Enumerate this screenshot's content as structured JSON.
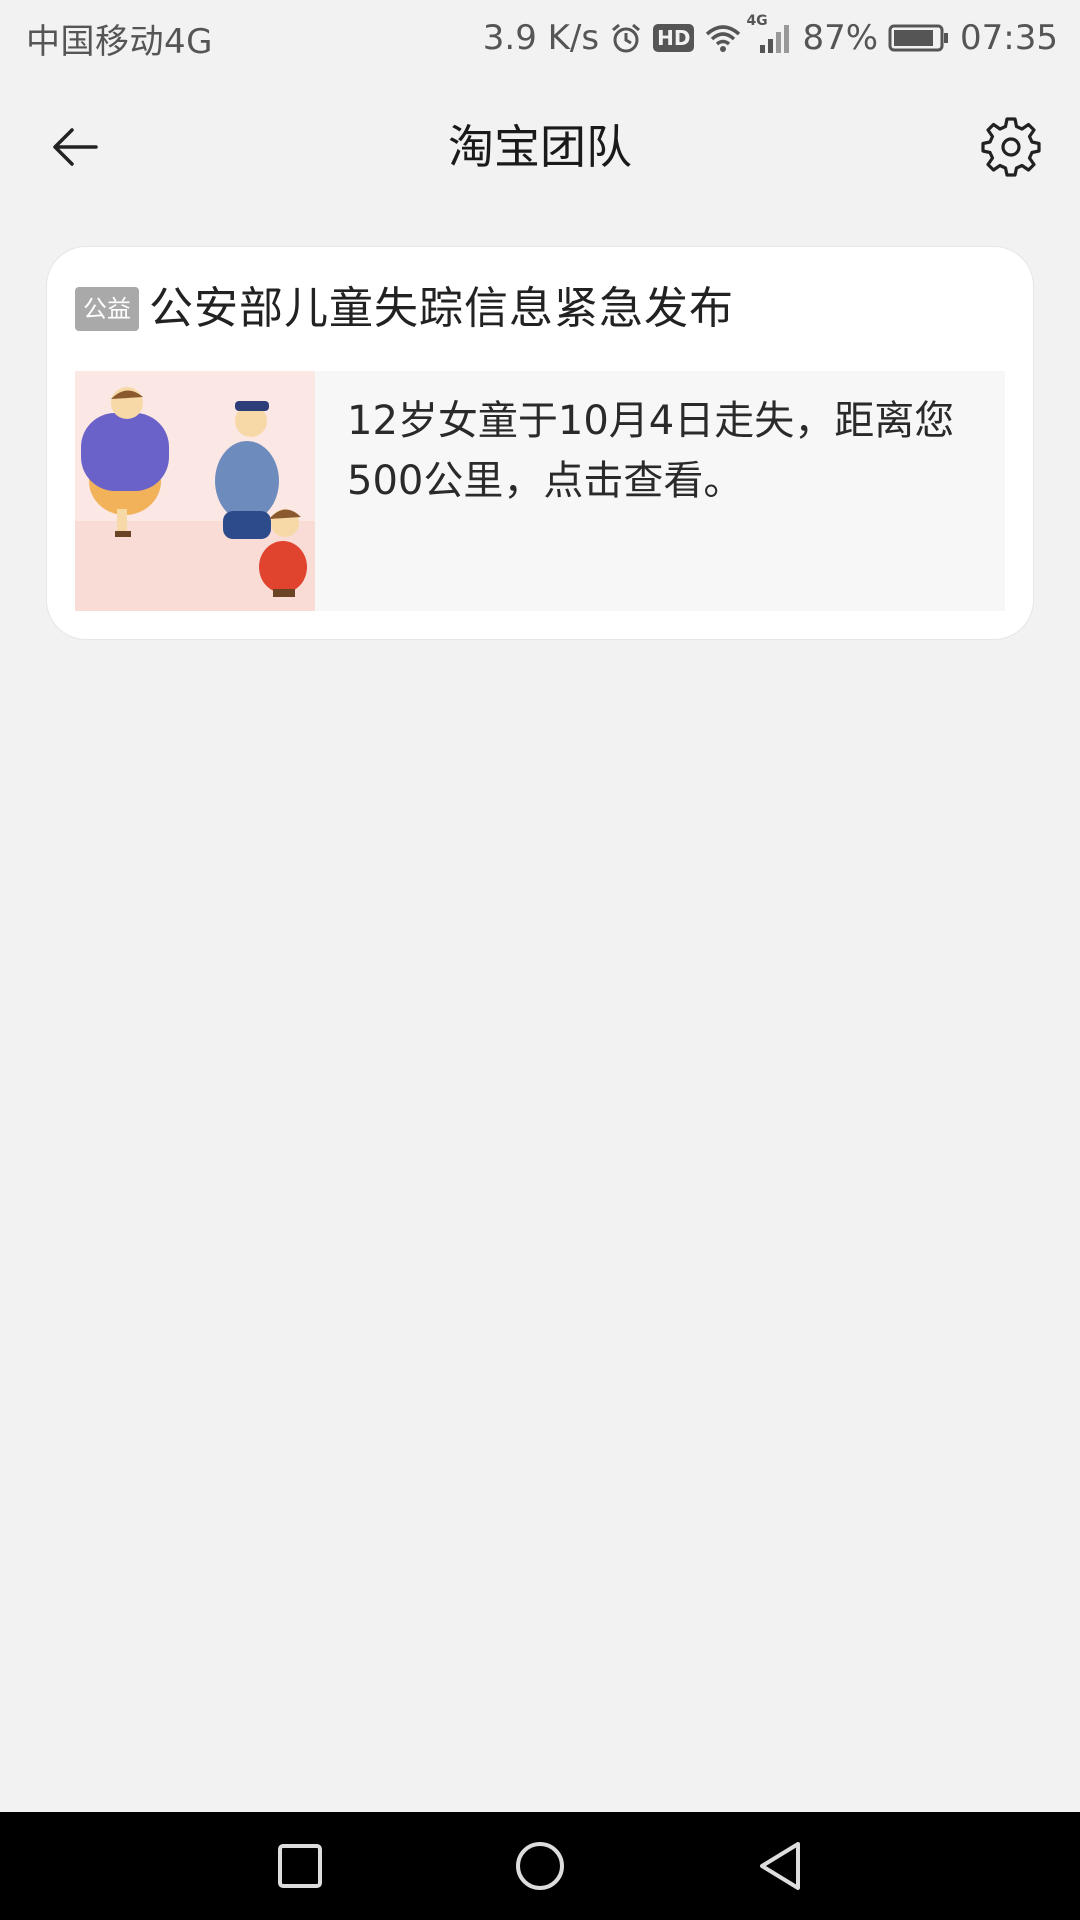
{
  "status_bar": {
    "carrier": "中国移动4G",
    "net_speed": "3.9 K/s",
    "hd_label": "HD",
    "signal_label": "4G",
    "battery": "87%",
    "time": "07:35",
    "icons": [
      "alarm-icon",
      "hd-icon",
      "wifi-icon",
      "signal-icon",
      "battery-icon"
    ]
  },
  "header": {
    "title": "淘宝团队",
    "back_icon": "arrow-left-icon",
    "settings_icon": "gear-icon"
  },
  "message_card": {
    "tag": "公益",
    "title": "公安部儿童失踪信息紧急发布",
    "description": "12岁女童于10月4日走失，距离您500公里，点击查看。",
    "thumbnail": "illustration-adults-and-child"
  },
  "system_nav": {
    "icons": [
      "recent-apps-icon",
      "home-icon",
      "back-triangle-icon"
    ]
  },
  "colors": {
    "background": "#f2f2f2",
    "card": "#ffffff",
    "tag_bg": "#a9a9a9",
    "nav_bar": "#000000"
  }
}
